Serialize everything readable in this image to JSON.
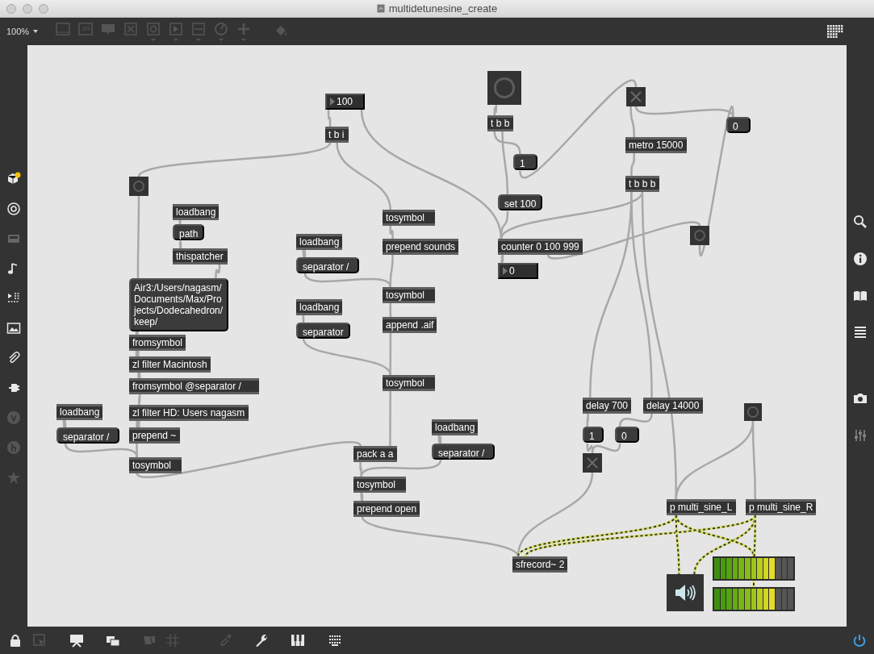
{
  "window": {
    "title": "multidetunesine_create"
  },
  "toolbar": {
    "zoom": "100%"
  },
  "patcher": {
    "boxes": [
      {
        "kind": "number",
        "text": "100"
      },
      {
        "kind": "object",
        "text": "t b i"
      },
      {
        "kind": "bang"
      },
      {
        "kind": "object",
        "text": "loadbang"
      },
      {
        "kind": "message",
        "text": "path"
      },
      {
        "kind": "object",
        "text": "thispatcher"
      },
      {
        "kind": "message",
        "text": "Air3:/Users/nagasm/Documents/Max/Projects/Dodecahedron/keep/"
      },
      {
        "kind": "object",
        "text": "fromsymbol"
      },
      {
        "kind": "object",
        "text": "zl filter Macintosh"
      },
      {
        "kind": "object",
        "text": "fromsymbol @separator /"
      },
      {
        "kind": "object",
        "text": "zl filter HD: Users nagasm"
      },
      {
        "kind": "object",
        "text": "prepend ~"
      },
      {
        "kind": "object",
        "text": "tosymbol"
      },
      {
        "kind": "object",
        "text": "loadbang"
      },
      {
        "kind": "message",
        "text": "separator /"
      },
      {
        "kind": "object",
        "text": "tosymbol"
      },
      {
        "kind": "object",
        "text": "prepend sounds"
      },
      {
        "kind": "object",
        "text": "loadbang"
      },
      {
        "kind": "message",
        "text": "separator /"
      },
      {
        "kind": "object",
        "text": "tosymbol"
      },
      {
        "kind": "object",
        "text": "loadbang"
      },
      {
        "kind": "message",
        "text": "separator"
      },
      {
        "kind": "object",
        "text": "append .aif"
      },
      {
        "kind": "object",
        "text": "tosymbol"
      },
      {
        "kind": "object",
        "text": "pack a a"
      },
      {
        "kind": "object",
        "text": "loadbang"
      },
      {
        "kind": "message",
        "text": "separator /"
      },
      {
        "kind": "object",
        "text": "tosymbol"
      },
      {
        "kind": "object",
        "text": "prepend open"
      },
      {
        "kind": "bang"
      },
      {
        "kind": "object",
        "text": "t b b"
      },
      {
        "kind": "message",
        "text": "1"
      },
      {
        "kind": "message",
        "text": "set 100"
      },
      {
        "kind": "object",
        "text": "counter 0 100 999"
      },
      {
        "kind": "number",
        "text": "0"
      },
      {
        "kind": "toggle",
        "checked": false
      },
      {
        "kind": "object",
        "text": "metro 15000"
      },
      {
        "kind": "object",
        "text": "t b b b"
      },
      {
        "kind": "message",
        "text": "0"
      },
      {
        "kind": "bang"
      },
      {
        "kind": "object",
        "text": "delay 700"
      },
      {
        "kind": "object",
        "text": "delay 14000"
      },
      {
        "kind": "message",
        "text": "1"
      },
      {
        "kind": "message",
        "text": "0"
      },
      {
        "kind": "toggle",
        "checked": false
      },
      {
        "kind": "bang"
      },
      {
        "kind": "object",
        "text": "p multi_sine_L"
      },
      {
        "kind": "object",
        "text": "p multi_sine_R"
      },
      {
        "kind": "object",
        "text": "sfrecord~ 2"
      },
      {
        "kind": "ezdac"
      },
      {
        "kind": "meter",
        "level": 0.77
      },
      {
        "kind": "meter",
        "level": 0.77
      }
    ]
  }
}
